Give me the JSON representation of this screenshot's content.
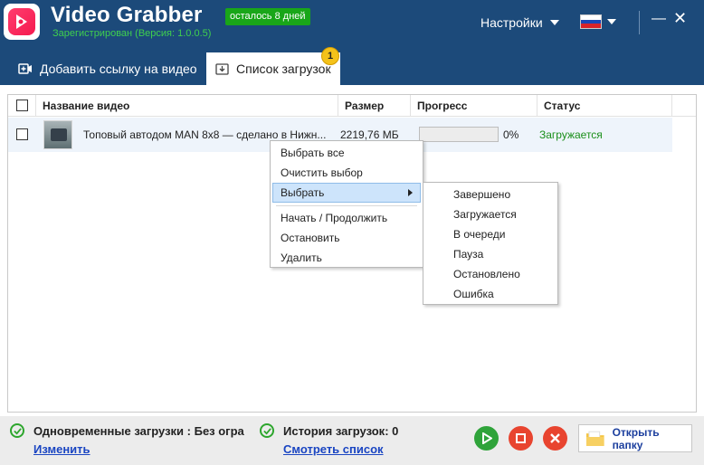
{
  "app": {
    "title": "Video Grabber",
    "trial_badge": "осталось 8 дней",
    "subtitle": "Зарегистрирован (Версия: 1.0.0.5)",
    "settings_label": "Настройки",
    "icons": [
      "video-logo-icon",
      "chevron-down-icon",
      "russia-flag-icon",
      "minimize-icon",
      "close-icon"
    ],
    "colors": {
      "header": "#1c4a7a",
      "accent_red": "#f51a4f",
      "badge_green": "#19a619",
      "status_green": "#1a8f1a",
      "link": "#1a45c2"
    }
  },
  "tabs": [
    {
      "label": "Добавить ссылку на видео",
      "icon": "video-add-icon"
    },
    {
      "label": "Список загрузок",
      "icon": "download-icon",
      "badge": "1",
      "active": true
    }
  ],
  "table": {
    "columns": [
      "Название видео",
      "Размер",
      "Прогресс",
      "Статус"
    ],
    "rows": [
      {
        "title": "Топовый автодом MAN 8x8 — сделано в Нижн...",
        "size": "2219,76 МБ",
        "progress_percent": 0,
        "progress_label": "0%",
        "status": "Загружается"
      }
    ]
  },
  "context_menu": {
    "items": [
      "Выбрать все",
      "Очистить выбор",
      "Выбрать",
      "Начать / Продолжить",
      "Остановить",
      "Удалить"
    ],
    "selected": "Выбрать"
  },
  "submenu": {
    "items": [
      "Завершено",
      "Загружается",
      "В очереди",
      "Пауза",
      "Остановлено",
      "Ошибка"
    ]
  },
  "footer": {
    "concurrent_label": "Одновременные загрузки : Без огра",
    "change_link": "Изменить",
    "history_label": "История загрузок: 0",
    "view_list_link": "Смотреть список",
    "open_folder_label": "Открыть папку",
    "buttons": [
      "play-icon",
      "stop-icon",
      "delete-icon"
    ]
  }
}
